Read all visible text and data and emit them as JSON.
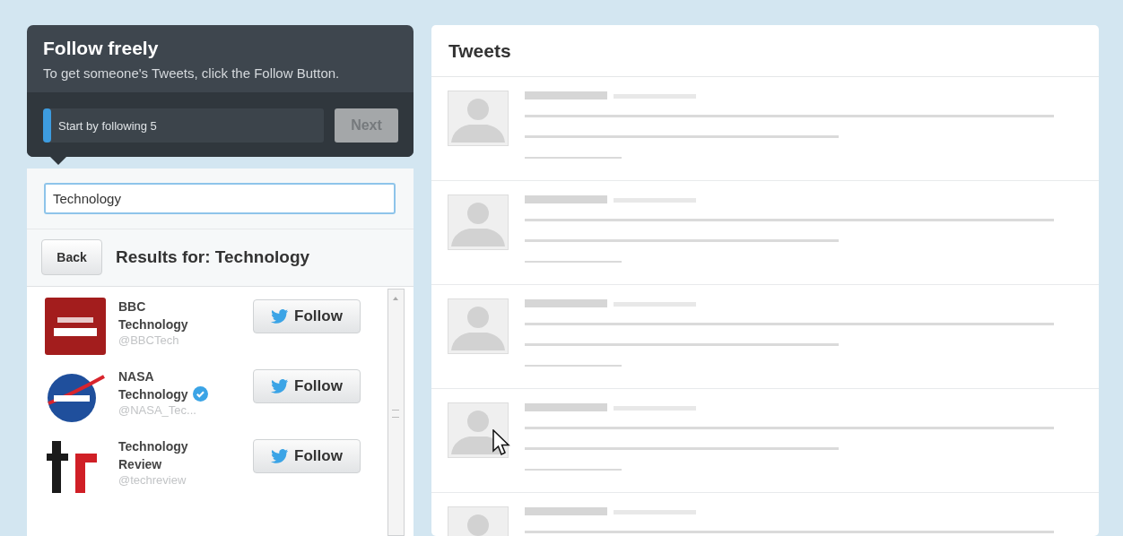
{
  "onboarding": {
    "title": "Follow freely",
    "description": "To get someone's Tweets, click the Follow Button.",
    "progress": {
      "label": "Start by following 5",
      "level": 0.03
    },
    "next_button": {
      "label": "Next",
      "disabled": true
    }
  },
  "search": {
    "value": "Technology"
  },
  "results": {
    "back_button": "Back",
    "heading": "Results for: Technology"
  },
  "accounts": [
    {
      "kind": "square",
      "name": "BBC Technology",
      "handle": "@BBCTech",
      "verified": false,
      "follow_button": "Follow"
    },
    {
      "kind": "circle",
      "name": "NASA Technology",
      "handle": "@NASA_Tec...",
      "verified": true,
      "follow_button": "Follow"
    },
    {
      "kind": "bars",
      "name": "Technology Review",
      "handle": "@techreview",
      "verified": false,
      "follow_button": "Follow"
    }
  ],
  "tweets": {
    "title": "Tweets",
    "rows": [
      {
        "kind": "skeleton"
      },
      {
        "kind": "skeleton"
      },
      {
        "kind": "skeleton"
      },
      {
        "kind": "skeleton"
      },
      {
        "kind": "skeleton"
      }
    ]
  }
}
